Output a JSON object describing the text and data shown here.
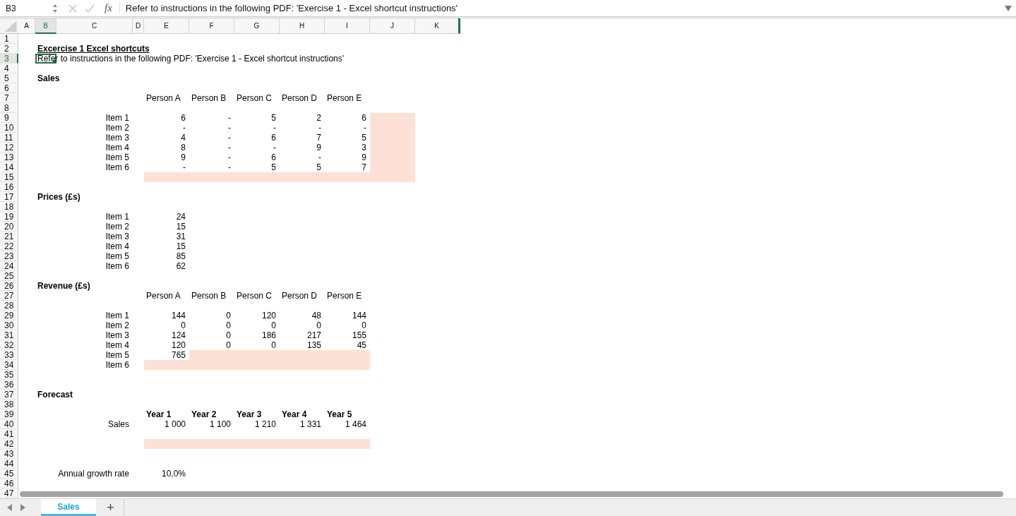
{
  "formula_bar": {
    "name_box": "B3",
    "function_label": "fx",
    "formula": "Refer to instructions in the following PDF: 'Exercise 1 - Excel shortcut instructions'"
  },
  "column_headers": [
    {
      "label": "A",
      "selected": false
    },
    {
      "label": "B",
      "selected": true
    },
    {
      "label": "C",
      "selected": false
    },
    {
      "label": "D",
      "selected": false
    },
    {
      "label": "E",
      "selected": false
    },
    {
      "label": "F",
      "selected": false
    },
    {
      "label": "G",
      "selected": false
    },
    {
      "label": "H",
      "selected": false
    },
    {
      "label": "I",
      "selected": false
    },
    {
      "label": "J",
      "selected": false
    },
    {
      "label": "K",
      "selected": false
    }
  ],
  "rows": [
    {
      "label": "1",
      "selected": false,
      "kind": "empty"
    },
    {
      "label": "2",
      "selected": false,
      "kind": "title",
      "cells": {
        "B": {
          "text": "Excercise 1 Excel shortcuts"
        }
      }
    },
    {
      "label": "3",
      "selected": true,
      "kind": "note",
      "cells": {
        "B": {
          "text": "Refer to instructions in the following PDF: 'Exercise 1 - Excel shortcut instructions'"
        }
      }
    },
    {
      "label": "4",
      "selected": false,
      "kind": "empty"
    },
    {
      "label": "5",
      "selected": false,
      "kind": "section",
      "cells": {
        "B": {
          "text": "Sales"
        }
      }
    },
    {
      "label": "6",
      "selected": false,
      "kind": "empty"
    },
    {
      "label": "7",
      "selected": false,
      "kind": "header",
      "cells": {
        "E": {
          "text": "Person A"
        },
        "F": {
          "text": "Person B"
        },
        "G": {
          "text": "Person C"
        },
        "H": {
          "text": "Person D"
        },
        "I": {
          "text": "Person E"
        }
      }
    },
    {
      "label": "8",
      "selected": false,
      "kind": "empty"
    },
    {
      "label": "9",
      "selected": false,
      "kind": "data",
      "cells": {
        "C": {
          "text": "Item 1"
        },
        "E": {
          "text": "6"
        },
        "F": {
          "text": "-"
        },
        "G": {
          "text": "5"
        },
        "H": {
          "text": "2"
        },
        "I": {
          "text": "6"
        },
        "J": {
          "highlighted": true
        }
      }
    },
    {
      "label": "10",
      "selected": false,
      "kind": "data",
      "cells": {
        "C": {
          "text": "Item 2"
        },
        "E": {
          "text": "-"
        },
        "F": {
          "text": "-"
        },
        "G": {
          "text": "-"
        },
        "H": {
          "text": "-"
        },
        "I": {
          "text": "-"
        },
        "J": {
          "highlighted": true
        }
      }
    },
    {
      "label": "11",
      "selected": false,
      "kind": "data",
      "cells": {
        "C": {
          "text": "Item 3"
        },
        "E": {
          "text": "4"
        },
        "F": {
          "text": "-"
        },
        "G": {
          "text": "6"
        },
        "H": {
          "text": "7"
        },
        "I": {
          "text": "5"
        },
        "J": {
          "highlighted": true
        }
      }
    },
    {
      "label": "12",
      "selected": false,
      "kind": "data",
      "cells": {
        "C": {
          "text": "Item 4"
        },
        "E": {
          "text": "8"
        },
        "F": {
          "text": "-"
        },
        "G": {
          "text": "-"
        },
        "H": {
          "text": "9"
        },
        "I": {
          "text": "3"
        },
        "J": {
          "highlighted": true
        }
      }
    },
    {
      "label": "13",
      "selected": false,
      "kind": "data",
      "cells": {
        "C": {
          "text": "Item 5"
        },
        "E": {
          "text": "9"
        },
        "F": {
          "text": "-"
        },
        "G": {
          "text": "6"
        },
        "H": {
          "text": "-"
        },
        "I": {
          "text": "9"
        },
        "J": {
          "highlighted": true
        }
      }
    },
    {
      "label": "14",
      "selected": false,
      "kind": "data",
      "cells": {
        "C": {
          "text": "Item 6"
        },
        "E": {
          "text": "-"
        },
        "F": {
          "text": "-"
        },
        "G": {
          "text": "5"
        },
        "H": {
          "text": "5"
        },
        "I": {
          "text": "7"
        },
        "J": {
          "highlighted": true
        }
      }
    },
    {
      "label": "15",
      "selected": false,
      "kind": "data",
      "cells": {
        "E": {
          "highlighted": true
        },
        "F": {
          "highlighted": true
        },
        "G": {
          "highlighted": true
        },
        "H": {
          "highlighted": true
        },
        "I": {
          "highlighted": true
        },
        "J": {
          "highlighted": true
        }
      }
    },
    {
      "label": "16",
      "selected": false,
      "kind": "empty"
    },
    {
      "label": "17",
      "selected": false,
      "kind": "section",
      "cells": {
        "B": {
          "text": "Prices (£s)"
        }
      }
    },
    {
      "label": "18",
      "selected": false,
      "kind": "empty"
    },
    {
      "label": "19",
      "selected": false,
      "kind": "data",
      "cells": {
        "C": {
          "text": "Item 1"
        },
        "E": {
          "text": "24"
        }
      }
    },
    {
      "label": "20",
      "selected": false,
      "kind": "data",
      "cells": {
        "C": {
          "text": "Item 2"
        },
        "E": {
          "text": "15"
        }
      }
    },
    {
      "label": "21",
      "selected": false,
      "kind": "data",
      "cells": {
        "C": {
          "text": "Item 3"
        },
        "E": {
          "text": "31"
        }
      }
    },
    {
      "label": "22",
      "selected": false,
      "kind": "data",
      "cells": {
        "C": {
          "text": "Item 4"
        },
        "E": {
          "text": "15"
        }
      }
    },
    {
      "label": "23",
      "selected": false,
      "kind": "data",
      "cells": {
        "C": {
          "text": "Item 5"
        },
        "E": {
          "text": "85"
        }
      }
    },
    {
      "label": "24",
      "selected": false,
      "kind": "data",
      "cells": {
        "C": {
          "text": "Item 6"
        },
        "E": {
          "text": "62"
        }
      }
    },
    {
      "label": "25",
      "selected": false,
      "kind": "empty"
    },
    {
      "label": "26",
      "selected": false,
      "kind": "section",
      "cells": {
        "B": {
          "text": "Revenue (£s)"
        }
      }
    },
    {
      "label": "27",
      "selected": false,
      "kind": "header",
      "cells": {
        "E": {
          "text": "Person A"
        },
        "F": {
          "text": "Person B"
        },
        "G": {
          "text": "Person C"
        },
        "H": {
          "text": "Person D"
        },
        "I": {
          "text": "Person E"
        }
      }
    },
    {
      "label": "28",
      "selected": false,
      "kind": "empty"
    },
    {
      "label": "29",
      "selected": false,
      "kind": "data",
      "cells": {
        "C": {
          "text": "Item 1"
        },
        "E": {
          "text": "144"
        },
        "F": {
          "text": "0"
        },
        "G": {
          "text": "120"
        },
        "H": {
          "text": "48"
        },
        "I": {
          "text": "144"
        }
      }
    },
    {
      "label": "30",
      "selected": false,
      "kind": "data",
      "cells": {
        "C": {
          "text": "Item 2"
        },
        "E": {
          "text": "0"
        },
        "F": {
          "text": "0"
        },
        "G": {
          "text": "0"
        },
        "H": {
          "text": "0"
        },
        "I": {
          "text": "0"
        }
      }
    },
    {
      "label": "31",
      "selected": false,
      "kind": "data",
      "cells": {
        "C": {
          "text": "Item 3"
        },
        "E": {
          "text": "124"
        },
        "F": {
          "text": "0"
        },
        "G": {
          "text": "186"
        },
        "H": {
          "text": "217"
        },
        "I": {
          "text": "155"
        }
      }
    },
    {
      "label": "32",
      "selected": false,
      "kind": "data",
      "cells": {
        "C": {
          "text": "Item 4"
        },
        "E": {
          "text": "120"
        },
        "F": {
          "text": "0"
        },
        "G": {
          "text": "0"
        },
        "H": {
          "text": "135"
        },
        "I": {
          "text": "45"
        }
      }
    },
    {
      "label": "33",
      "selected": false,
      "kind": "data",
      "cells": {
        "C": {
          "text": "Item 5"
        },
        "E": {
          "text": "765"
        },
        "F": {
          "highlighted": true
        },
        "G": {
          "highlighted": true
        },
        "H": {
          "highlighted": true
        },
        "I": {
          "highlighted": true
        }
      }
    },
    {
      "label": "34",
      "selected": false,
      "kind": "data",
      "cells": {
        "C": {
          "text": "Item 6"
        },
        "E": {
          "highlighted": true
        },
        "F": {
          "highlighted": true
        },
        "G": {
          "highlighted": true
        },
        "H": {
          "highlighted": true
        },
        "I": {
          "highlighted": true
        }
      }
    },
    {
      "label": "35",
      "selected": false,
      "kind": "empty"
    },
    {
      "label": "36",
      "selected": false,
      "kind": "empty"
    },
    {
      "label": "37",
      "selected": false,
      "kind": "section",
      "cells": {
        "B": {
          "text": "Forecast"
        }
      }
    },
    {
      "label": "38",
      "selected": false,
      "kind": "empty"
    },
    {
      "label": "39",
      "selected": false,
      "kind": "bold_header",
      "cells": {
        "E": {
          "text": "Year 1"
        },
        "F": {
          "text": "Year 2"
        },
        "G": {
          "text": "Year 3"
        },
        "H": {
          "text": "Year 4"
        },
        "I": {
          "text": "Year 5"
        }
      }
    },
    {
      "label": "40",
      "selected": false,
      "kind": "data",
      "cells": {
        "C": {
          "text": "Sales"
        },
        "E": {
          "text": "1 000"
        },
        "F": {
          "text": "1 100"
        },
        "G": {
          "text": "1 210"
        },
        "H": {
          "text": "1 331"
        },
        "I": {
          "text": "1 464"
        }
      }
    },
    {
      "label": "41",
      "selected": false,
      "kind": "empty"
    },
    {
      "label": "42",
      "selected": false,
      "kind": "data",
      "cells": {
        "E": {
          "highlighted": true
        },
        "F": {
          "highlighted": true
        },
        "G": {
          "highlighted": true
        },
        "H": {
          "highlighted": true
        },
        "I": {
          "highlighted": true
        }
      }
    },
    {
      "label": "43",
      "selected": false,
      "kind": "empty"
    },
    {
      "label": "44",
      "selected": false,
      "kind": "empty"
    },
    {
      "label": "45",
      "selected": false,
      "kind": "data",
      "cells": {
        "C": {
          "text": "Annual growth rate"
        },
        "E": {
          "text": "10,0%"
        }
      }
    },
    {
      "label": "46",
      "selected": false,
      "kind": "empty"
    },
    {
      "label": "47",
      "selected": false,
      "kind": "empty"
    }
  ],
  "sheet_tabs": [
    {
      "label": "Sales",
      "selected": true
    }
  ],
  "add_sheet_label": "+"
}
